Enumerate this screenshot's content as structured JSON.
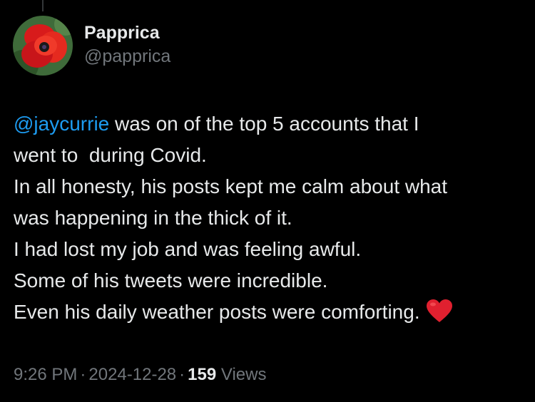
{
  "author": {
    "display_name": "Papprica",
    "handle": "@papprica",
    "avatar_icon": "red-poppy-avatar"
  },
  "tweet": {
    "mention": "@jaycurrie",
    "line1_rest": " was on of the top 5 accounts that I",
    "lines": [
      "went to  during Covid.",
      "In all honesty, his posts kept me calm about what",
      "was happening in the thick of it.",
      "I had lost my job and was feeling awful.",
      "Some of his tweets were incredible."
    ],
    "last_line": "Even his daily weather posts were comforting.",
    "emoji_icon": "red-heart-icon"
  },
  "meta": {
    "time": "9:26 PM",
    "separator": "·",
    "date": "2024-12-28",
    "views_count": "159",
    "views_label": "Views"
  },
  "colors": {
    "background": "#000000",
    "text": "#e7e9ea",
    "secondary_text": "#71767b",
    "mention": "#1d9bf0",
    "heart": "#e0202f"
  }
}
